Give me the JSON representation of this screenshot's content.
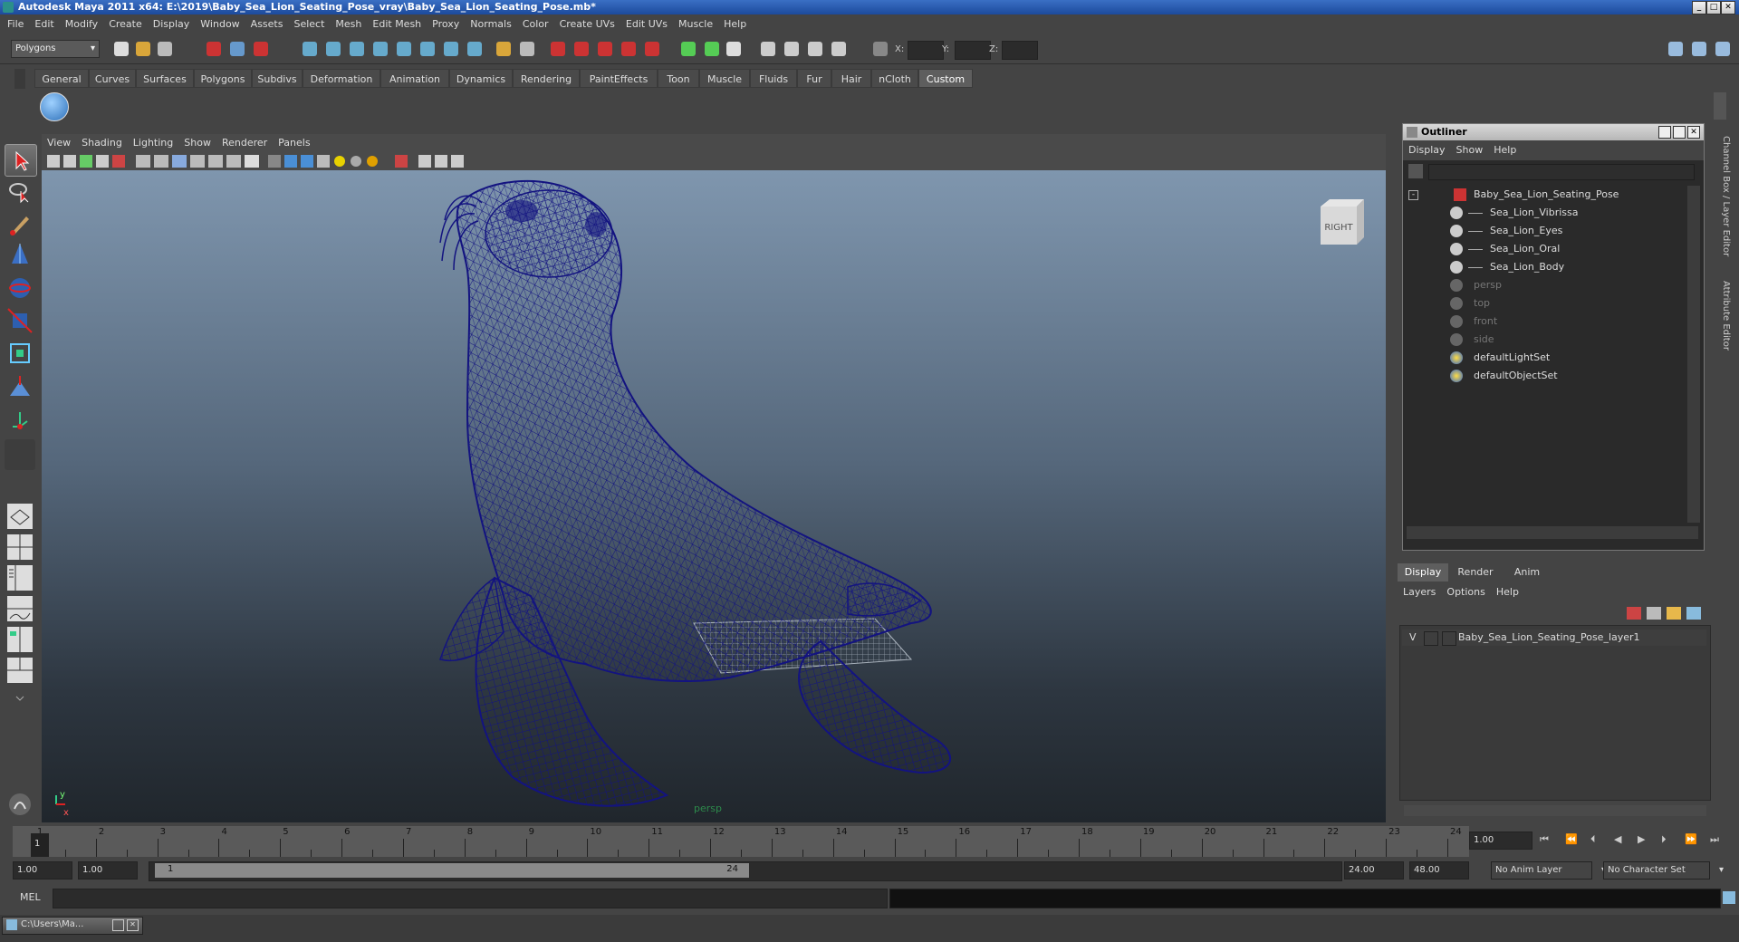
{
  "window": {
    "title": "Autodesk Maya 2011 x64: E:\\2019\\Baby_Sea_Lion_Seating_Pose_vray\\Baby_Sea_Lion_Seating_Pose.mb*"
  },
  "menubar": [
    "File",
    "Edit",
    "Modify",
    "Create",
    "Display",
    "Window",
    "Assets",
    "Select",
    "Mesh",
    "Edit Mesh",
    "Proxy",
    "Normals",
    "Color",
    "Create UVs",
    "Edit UVs",
    "Muscle",
    "Help"
  ],
  "statusline": {
    "menu_set": "Polygons",
    "x_label": "X:",
    "y_label": "Y:",
    "z_label": "Z:"
  },
  "shelf_tabs": [
    "General",
    "Curves",
    "Surfaces",
    "Polygons",
    "Subdivs",
    "Deformation",
    "Animation",
    "Dynamics",
    "Rendering",
    "PaintEffects",
    "Toon",
    "Muscle",
    "Fluids",
    "Fur",
    "Hair",
    "nCloth",
    "Custom"
  ],
  "shelf_active_tab": "Custom",
  "viewport": {
    "menus": [
      "View",
      "Shading",
      "Lighting",
      "Show",
      "Renderer",
      "Panels"
    ],
    "camera_label": "persp",
    "viewcube_label": "RIGHT",
    "axis_y": "y",
    "axis_x": "x",
    "wire_color": "#131380"
  },
  "outliner": {
    "title": "Outliner",
    "menus": [
      "Display",
      "Show",
      "Help"
    ],
    "items": [
      {
        "label": "Baby_Sea_Lion_Seating_Pose",
        "depth": 0,
        "expand": "-",
        "icon": "transform-icon",
        "dim": false
      },
      {
        "label": "Sea_Lion_Vibrissa",
        "depth": 1,
        "icon": "mesh-icon",
        "dim": false
      },
      {
        "label": "Sea_Lion_Eyes",
        "depth": 1,
        "icon": "mesh-icon",
        "dim": false
      },
      {
        "label": "Sea_Lion_Oral",
        "depth": 1,
        "icon": "mesh-icon",
        "dim": false
      },
      {
        "label": "Sea_Lion_Body",
        "depth": 1,
        "icon": "mesh-icon",
        "dim": false
      },
      {
        "label": "persp",
        "depth": 0,
        "icon": "camera-icon",
        "dim": true
      },
      {
        "label": "top",
        "depth": 0,
        "icon": "camera-icon",
        "dim": true
      },
      {
        "label": "front",
        "depth": 0,
        "icon": "camera-icon",
        "dim": true
      },
      {
        "label": "side",
        "depth": 0,
        "icon": "camera-icon",
        "dim": true
      },
      {
        "label": "defaultLightSet",
        "depth": 0,
        "icon": "set-icon",
        "dim": false
      },
      {
        "label": "defaultObjectSet",
        "depth": 0,
        "icon": "set-icon",
        "dim": false
      }
    ]
  },
  "layer_editor": {
    "tabs": [
      "Display",
      "Render",
      "Anim"
    ],
    "active_tab": "Display",
    "menus": [
      "Layers",
      "Options",
      "Help"
    ],
    "layers": [
      {
        "visible": "V",
        "name": "Baby_Sea_Lion_Seating_Pose_layer1"
      }
    ]
  },
  "side_tabs": [
    "Channel Box / Layer Editor",
    "Attribute Editor"
  ],
  "timeline": {
    "frames": [
      "1",
      "2",
      "3",
      "4",
      "5",
      "6",
      "7",
      "8",
      "9",
      "10",
      "11",
      "12",
      "13",
      "14",
      "15",
      "16",
      "17",
      "18",
      "19",
      "20",
      "21",
      "22",
      "23",
      "24"
    ],
    "current_frame_marker": "1",
    "current_time": "1.00"
  },
  "range": {
    "start": "1.00",
    "playback_start": "1.00",
    "slider_start": "1",
    "slider_end": "24",
    "playback_end": "24.00",
    "end": "48.00",
    "anim_layer": "No Anim Layer",
    "character_set": "No Character Set"
  },
  "command_line": {
    "label": "MEL"
  },
  "taskbar": {
    "item": "C:\\Users\\Ma..."
  }
}
